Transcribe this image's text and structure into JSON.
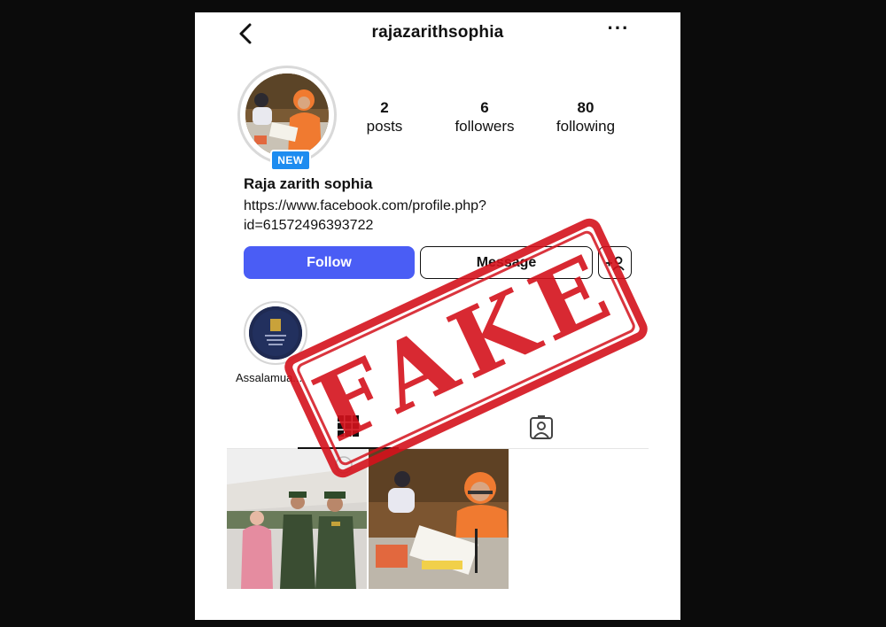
{
  "header": {
    "username": "rajazarithsophia",
    "more_label": "···"
  },
  "profile": {
    "new_badge": "NEW",
    "stats": [
      {
        "count": "2",
        "label": "posts"
      },
      {
        "count": "6",
        "label": "followers"
      },
      {
        "count": "80",
        "label": "following"
      }
    ],
    "display_name": "Raja zarith sophia",
    "bio_link_line1": "https://www.facebook.com/profile.php?",
    "bio_link_line2": "id=61572496393722"
  },
  "actions": {
    "follow_label": "Follow",
    "message_label": "Message",
    "add_user_label": "+👤"
  },
  "highlights": [
    {
      "label": "Assalamua..."
    }
  ],
  "tabs": [
    {
      "name": "grid-icon"
    },
    {
      "name": "tagged-icon"
    }
  ],
  "overlay": {
    "stamp_text": "FAKE",
    "stamp_color": "#d4121c"
  },
  "colors": {
    "follow_bg": "#4a5df5",
    "badge_bg": "#1d8cf0"
  }
}
